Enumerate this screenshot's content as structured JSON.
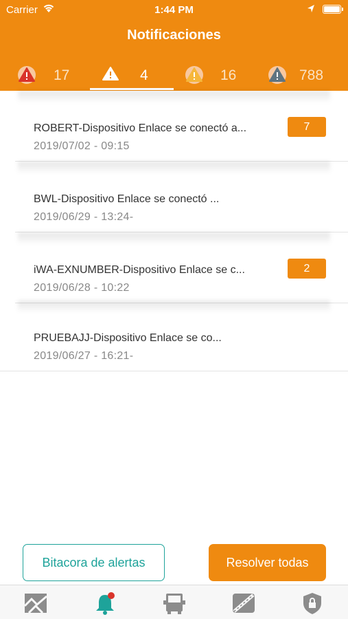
{
  "status_bar": {
    "carrier": "Carrier",
    "time": "1:44 PM"
  },
  "header": {
    "title": "Notificaciones"
  },
  "tabs": [
    {
      "count": "17",
      "icon": "warning-red-icon",
      "color": "#d9342b"
    },
    {
      "count": "4",
      "icon": "warning-white-icon",
      "color": "#ffffff"
    },
    {
      "count": "16",
      "icon": "warning-yellow-icon",
      "color": "#f6b73c"
    },
    {
      "count": "788",
      "icon": "warning-gray-icon",
      "color": "#5f7481"
    }
  ],
  "notifications": [
    {
      "name": "ROBERT-Dispositivo Enlace se conectó a...",
      "date": "2019/07/02 - 09:15",
      "badge": "7"
    },
    {
      "name": "BWL-Dispositivo Enlace se conectó ...",
      "date": "2019/06/29 - 13:24-",
      "badge": ""
    },
    {
      "name": "iWA-EXNUMBER-Dispositivo Enlace se c...",
      "date": "2019/06/28 - 10:22",
      "badge": "2"
    },
    {
      "name": "PRUEBAJJ-Dispositivo Enlace se co...",
      "date": "2019/06/27 - 16:21-",
      "badge": ""
    }
  ],
  "actions": {
    "log_label": "Bitacora de alertas",
    "resolve_label": "Resolver todas"
  },
  "tabbar": [
    {
      "icon": "map-icon"
    },
    {
      "icon": "bell-icon",
      "has_dot": true
    },
    {
      "icon": "truck-icon"
    },
    {
      "icon": "route-icon"
    },
    {
      "icon": "shield-lock-icon"
    }
  ],
  "colors": {
    "accent": "#ef8a10",
    "teal": "#1ea39a"
  }
}
